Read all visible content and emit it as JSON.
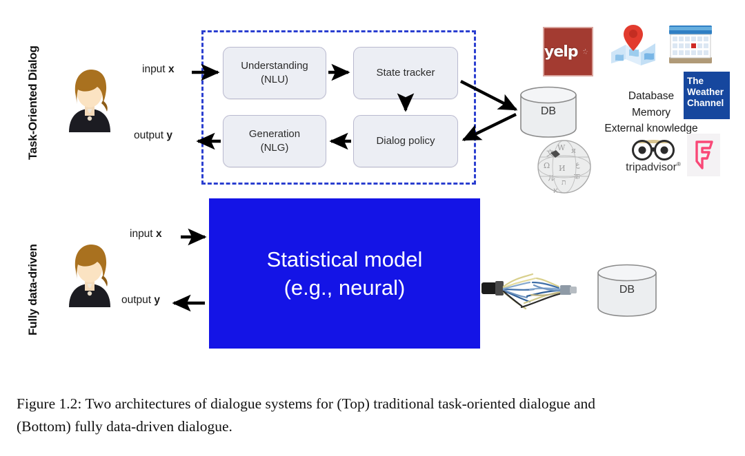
{
  "figure": {
    "caption_line1": "Figure 1.2: Two architectures of dialogue systems for (Top) traditional task-oriented dialogue and",
    "caption_line2": "(Bottom) fully data-driven dialogue."
  },
  "sections": {
    "top": {
      "side_label": "Task-Oriented Dialog",
      "input_label": "input",
      "input_var": "x",
      "output_label": "output",
      "output_var": "y",
      "modules": [
        {
          "id": "nlu",
          "line1": "Understanding",
          "line2": "(NLU)"
        },
        {
          "id": "state",
          "line1": "State tracker",
          "line2": ""
        },
        {
          "id": "policy",
          "line1": "Dialog policy",
          "line2": ""
        },
        {
          "id": "nlg",
          "line1": "Generation",
          "line2": "(NLG)"
        }
      ],
      "db_label": "DB",
      "knowledge": {
        "line1": "Database",
        "line2": "Memory",
        "line3": "External knowledge"
      },
      "logos": [
        {
          "name": "yelp-logo",
          "text": "yelp"
        },
        {
          "name": "map-location-logo",
          "text": ""
        },
        {
          "name": "calendar-logo",
          "text": ""
        },
        {
          "name": "weather-channel-logo",
          "line1": "The",
          "line2": "Weather",
          "line3": "Channel"
        },
        {
          "name": "wikipedia-logo",
          "text": ""
        },
        {
          "name": "tripadvisor-logo",
          "text": "tripadvisor"
        },
        {
          "name": "foursquare-logo",
          "text": "F"
        }
      ]
    },
    "bottom": {
      "side_label": "Fully data-driven",
      "input_label": "input",
      "input_var": "x",
      "output_label": "output",
      "output_var": "y",
      "model_line1": "Statistical model",
      "model_line2": "(e.g., neural)",
      "db_label": "DB"
    }
  },
  "colors": {
    "pipeline_border": "#2b3fd0",
    "model_fill": "#1414e6",
    "module_fill": "#eceef4",
    "yelp_red": "#a33b31",
    "weather_blue": "#16479e",
    "foursquare_pink": "#f94877"
  }
}
